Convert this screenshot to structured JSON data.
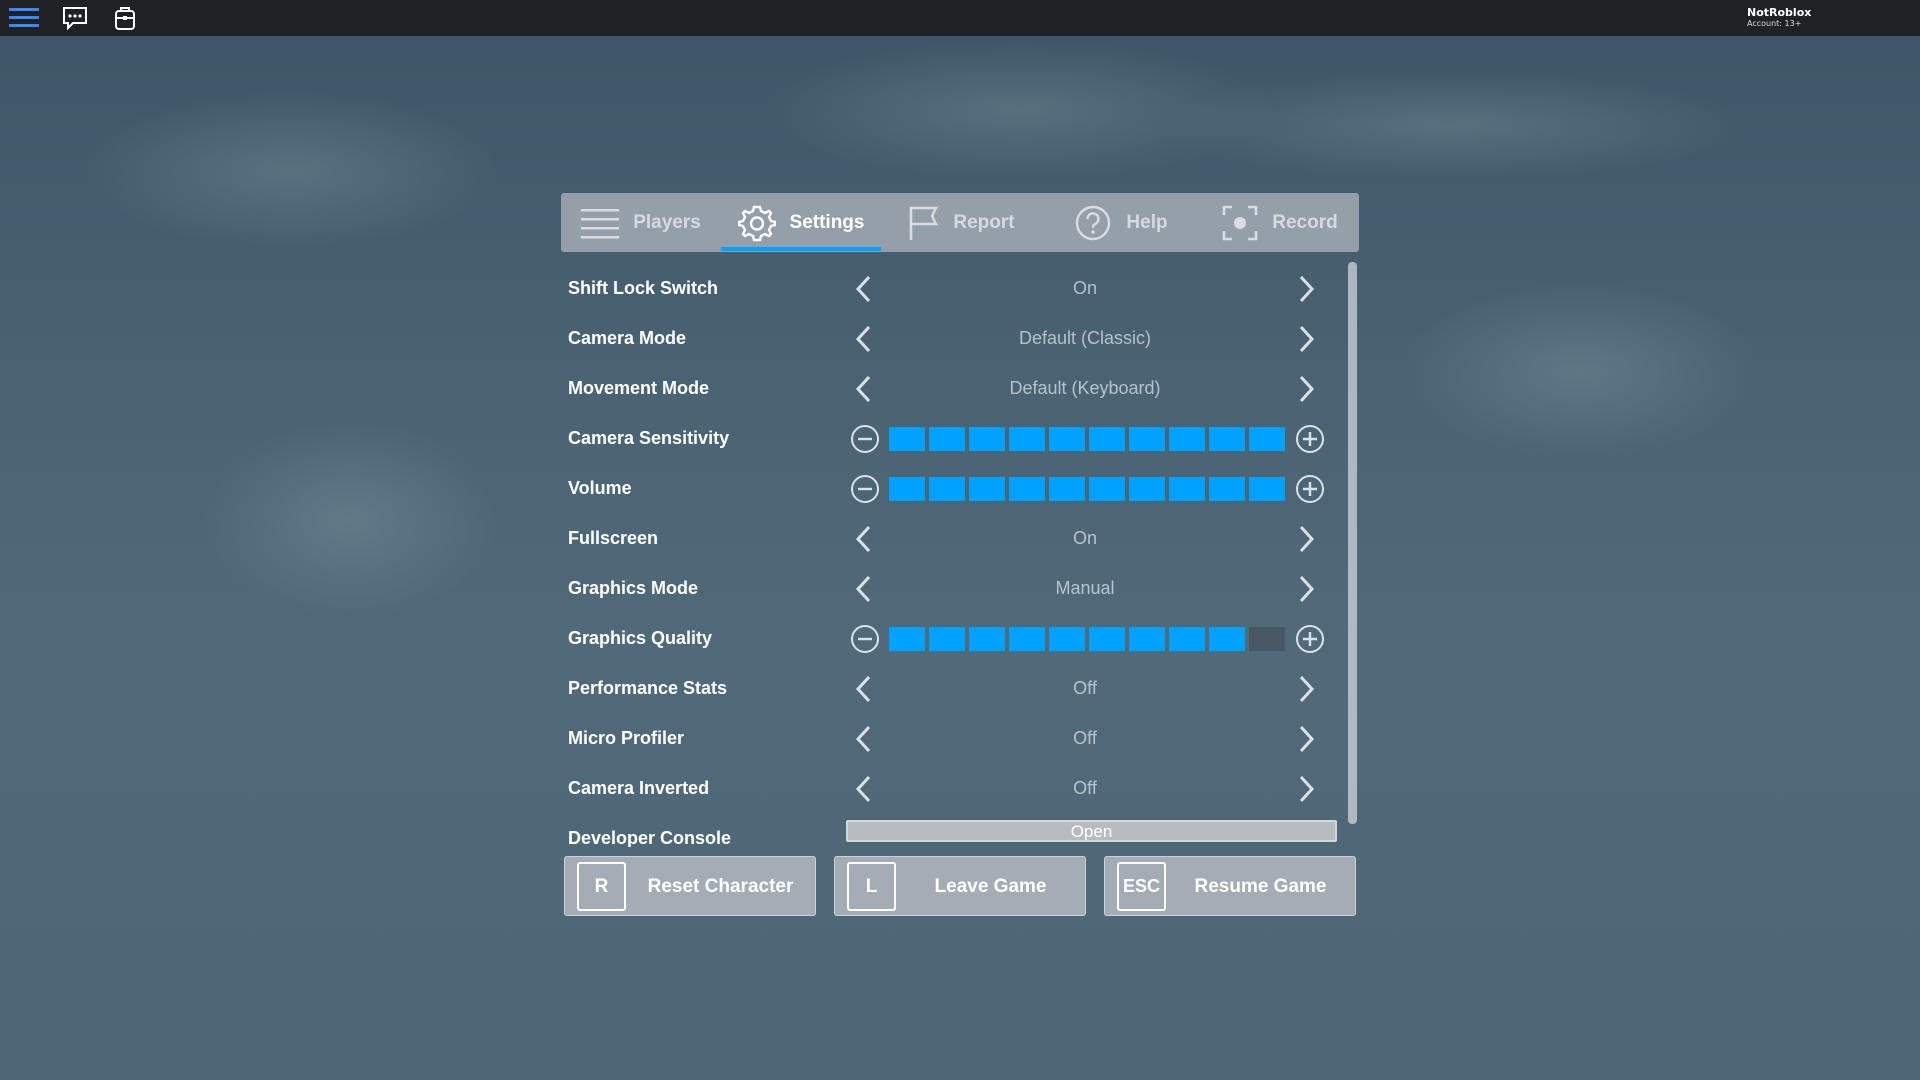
{
  "topbar": {
    "account_name": "NotRoblox",
    "account_age": "Account: 13+"
  },
  "tabs": [
    {
      "label": "Players",
      "icon": "players-list-icon",
      "active": false
    },
    {
      "label": "Settings",
      "icon": "gear-icon",
      "active": true
    },
    {
      "label": "Report",
      "icon": "flag-icon",
      "active": false
    },
    {
      "label": "Help",
      "icon": "help-icon",
      "active": false
    },
    {
      "label": "Record",
      "icon": "record-icon",
      "active": false
    }
  ],
  "settings": [
    {
      "label": "Shift Lock Switch",
      "type": "selector",
      "value": "On"
    },
    {
      "label": "Camera Mode",
      "type": "selector",
      "value": "Default (Classic)"
    },
    {
      "label": "Movement Mode",
      "type": "selector",
      "value": "Default (Keyboard)"
    },
    {
      "label": "Camera Sensitivity",
      "type": "slider",
      "level": 10,
      "max": 10
    },
    {
      "label": "Volume",
      "type": "slider",
      "level": 10,
      "max": 10
    },
    {
      "label": "Fullscreen",
      "type": "selector",
      "value": "On"
    },
    {
      "label": "Graphics Mode",
      "type": "selector",
      "value": "Manual"
    },
    {
      "label": "Graphics Quality",
      "type": "slider",
      "level": 9,
      "max": 10
    },
    {
      "label": "Performance Stats",
      "type": "selector",
      "value": "Off"
    },
    {
      "label": "Micro Profiler",
      "type": "selector",
      "value": "Off"
    },
    {
      "label": "Camera Inverted",
      "type": "selector",
      "value": "Off"
    },
    {
      "label": "Developer Console",
      "type": "button",
      "value": "Open"
    }
  ],
  "buttons": [
    {
      "key": "R",
      "label": "Reset Character"
    },
    {
      "key": "L",
      "label": "Leave Game"
    },
    {
      "key": "ESC",
      "label": "Resume Game"
    }
  ],
  "colors": {
    "accent": "#00a2ff",
    "topbar": "#1f2124"
  }
}
